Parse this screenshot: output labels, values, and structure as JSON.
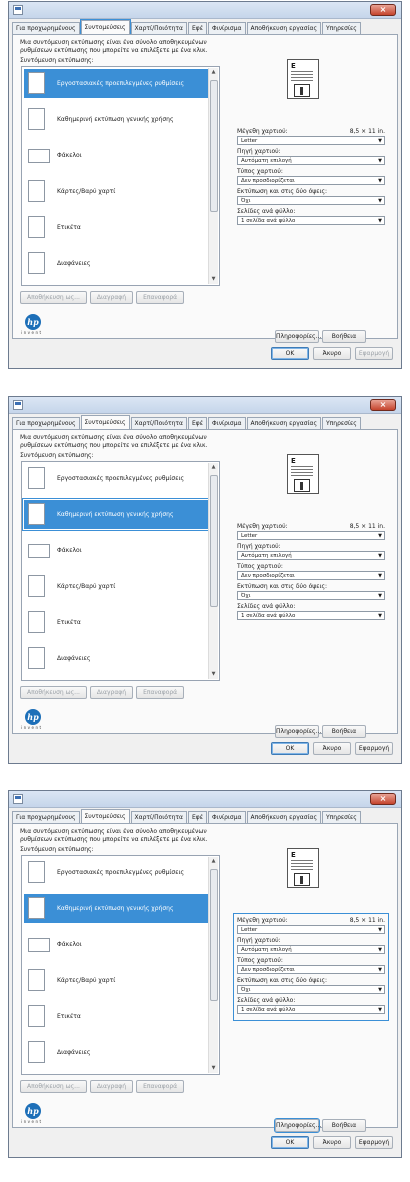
{
  "tabs": [
    "Για προχωρημένους",
    "Συντομεύσεις",
    "Χαρτί/Ποιότητα",
    "Εφέ",
    "Φινίρισμα",
    "Αποθήκευση εργασίας",
    "Υπηρεσίες"
  ],
  "description": "Μια συντόμευση εκτύπωσης είναι ένα σύνολο αποθηκευμένων ρυθμίσεων εκτύπωσης που μπορείτε να επιλέξετε με ένα κλικ.",
  "shortcuts_label": "Συντόμευση εκτύπωσης:",
  "shortcuts": [
    "Εργοστασιακές προεπιλεγμένες ρυθμίσεις",
    "Καθημερινή εκτύπωση γενικής χρήσης",
    "Φάκελοι",
    "Κάρτες/Βαρύ χαρτί",
    "Ετικέτα",
    "Διαφάνειες"
  ],
  "buttons": {
    "save_as": "Αποθήκευση ως...",
    "delete": "Διαγραφή",
    "reset": "Επαναφορά",
    "about": "Πληροφορίες...",
    "help": "Βοήθεια",
    "ok": "OK",
    "cancel": "Άκυρο",
    "apply": "Εφαρμογή"
  },
  "settings": {
    "paper_size_label": "Μέγεθη χαρτιού:",
    "paper_size_dims": "8,5 × 11 in.",
    "paper_size_value": "Letter",
    "paper_source_label": "Πηγή χαρτιού:",
    "paper_source_value": "Αυτόματη επιλογή",
    "paper_type_label": "Τύπος χαρτιού:",
    "paper_type_value": "Δεν προσδιορίζεται",
    "duplex_label": "Εκτύπωση και στις δύο όψεις:",
    "duplex_value": "Όχι",
    "pages_per_sheet_label": "Σελίδες ανά φύλλο:",
    "pages_per_sheet_value": "1 σελίδα ανά φύλλο"
  },
  "logo": {
    "mark": "hp",
    "tagline": "invent"
  },
  "dialogs": [
    {
      "selected_item": 0,
      "highlight": "tab"
    },
    {
      "selected_item": 1,
      "highlight": "item"
    },
    {
      "selected_item": 1,
      "highlight": "settings"
    }
  ],
  "accent": "#3b8fd6"
}
